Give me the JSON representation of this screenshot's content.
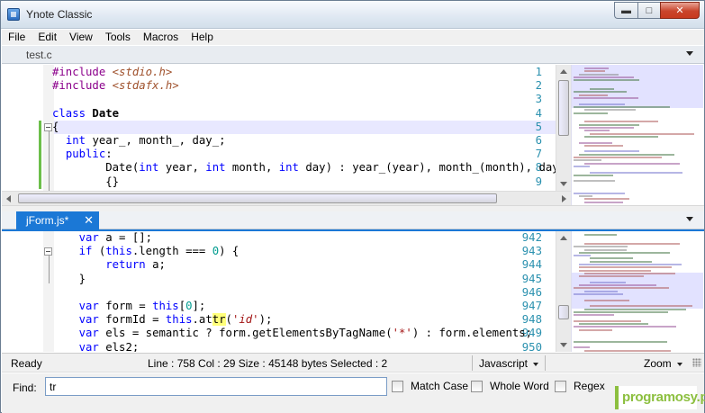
{
  "window": {
    "title": "Ynote Classic",
    "min_label": "▬",
    "max_label": "□",
    "close_label": "✕"
  },
  "menu": [
    "File",
    "Edit",
    "View",
    "Tools",
    "Macros",
    "Help"
  ],
  "top_pane": {
    "tab": "test.c",
    "lines": [
      {
        "n": "1",
        "tokens": [
          [
            "pp",
            "#include "
          ],
          [
            "inc",
            "<stdio.h>"
          ]
        ]
      },
      {
        "n": "2",
        "tokens": [
          [
            "pp",
            "#include "
          ],
          [
            "inc",
            "<stdafx.h>"
          ]
        ]
      },
      {
        "n": "3",
        "tokens": []
      },
      {
        "n": "4",
        "tokens": [
          [
            "kw",
            "class "
          ],
          [
            "b",
            "Date"
          ]
        ]
      },
      {
        "n": "5",
        "tokens": [
          [
            "",
            "{"
          ]
        ]
      },
      {
        "n": "6",
        "tokens": [
          [
            "",
            "  "
          ],
          [
            "kw",
            "int "
          ],
          [
            "",
            "year_, month_, day_;"
          ]
        ]
      },
      {
        "n": "7",
        "tokens": [
          [
            "",
            "  "
          ],
          [
            "kw",
            "public"
          ],
          [
            "",
            ":"
          ]
        ]
      },
      {
        "n": "8",
        "tokens": [
          [
            "",
            "        Date("
          ],
          [
            "kw",
            "int "
          ],
          [
            "",
            "year, "
          ],
          [
            "kw",
            "int "
          ],
          [
            "",
            "month, "
          ],
          [
            "kw",
            "int "
          ],
          [
            "",
            "day) : year_(year), month_(month), day_(da"
          ]
        ]
      },
      {
        "n": "9",
        "tokens": [
          [
            "",
            "        {}"
          ]
        ]
      }
    ]
  },
  "bottom_pane": {
    "tab": "jForm.js*",
    "tab_close": "✕",
    "lines": [
      {
        "n": "942",
        "tokens": [
          [
            "",
            "    "
          ],
          [
            "kw",
            "var "
          ],
          [
            "",
            "a = [];"
          ]
        ]
      },
      {
        "n": "943",
        "tokens": [
          [
            "",
            "    "
          ],
          [
            "kw",
            "if "
          ],
          [
            "",
            "("
          ],
          [
            "kw",
            "this"
          ],
          [
            "",
            ".length === "
          ],
          [
            "num",
            "0"
          ],
          [
            "",
            ") {"
          ]
        ]
      },
      {
        "n": "944",
        "tokens": [
          [
            "",
            "        "
          ],
          [
            "kw",
            "return "
          ],
          [
            "",
            "a;"
          ]
        ]
      },
      {
        "n": "945",
        "tokens": [
          [
            "",
            "    }"
          ]
        ]
      },
      {
        "n": "946",
        "tokens": []
      },
      {
        "n": "947",
        "tokens": [
          [
            "",
            "    "
          ],
          [
            "kw",
            "var "
          ],
          [
            "",
            "form = "
          ],
          [
            "kw",
            "this"
          ],
          [
            "",
            "["
          ],
          [
            "num",
            "0"
          ],
          [
            "",
            "];"
          ]
        ]
      },
      {
        "n": "948",
        "tokens": [
          [
            "",
            "    "
          ],
          [
            "kw",
            "var "
          ],
          [
            "",
            "formId = "
          ],
          [
            "kw",
            "this"
          ],
          [
            "",
            ".at"
          ],
          [
            "mark",
            "tr"
          ],
          [
            "",
            "("
          ],
          [
            "str",
            "'id'"
          ],
          [
            "",
            ");"
          ]
        ]
      },
      {
        "n": "949",
        "tokens": [
          [
            "",
            "    "
          ],
          [
            "kw",
            "var "
          ],
          [
            "",
            "els = semantic ? form.getElementsByTagName("
          ],
          [
            "str",
            "'*'"
          ],
          [
            "",
            ") : form.elements;"
          ]
        ]
      },
      {
        "n": "950",
        "tokens": [
          [
            "",
            "    "
          ],
          [
            "kw",
            "var "
          ],
          [
            "",
            "els2;"
          ]
        ]
      }
    ]
  },
  "status": {
    "ready": "Ready",
    "info": "Line : 758 Col : 29 Size : 45148 bytes Selected : 2",
    "language": "Javascript",
    "zoom": "Zoom"
  },
  "find": {
    "label": "Find:",
    "value": "tr",
    "match_case": "Match Case",
    "whole_word": "Whole Word",
    "regex": "Regex"
  },
  "watermark": "programosy.pl"
}
